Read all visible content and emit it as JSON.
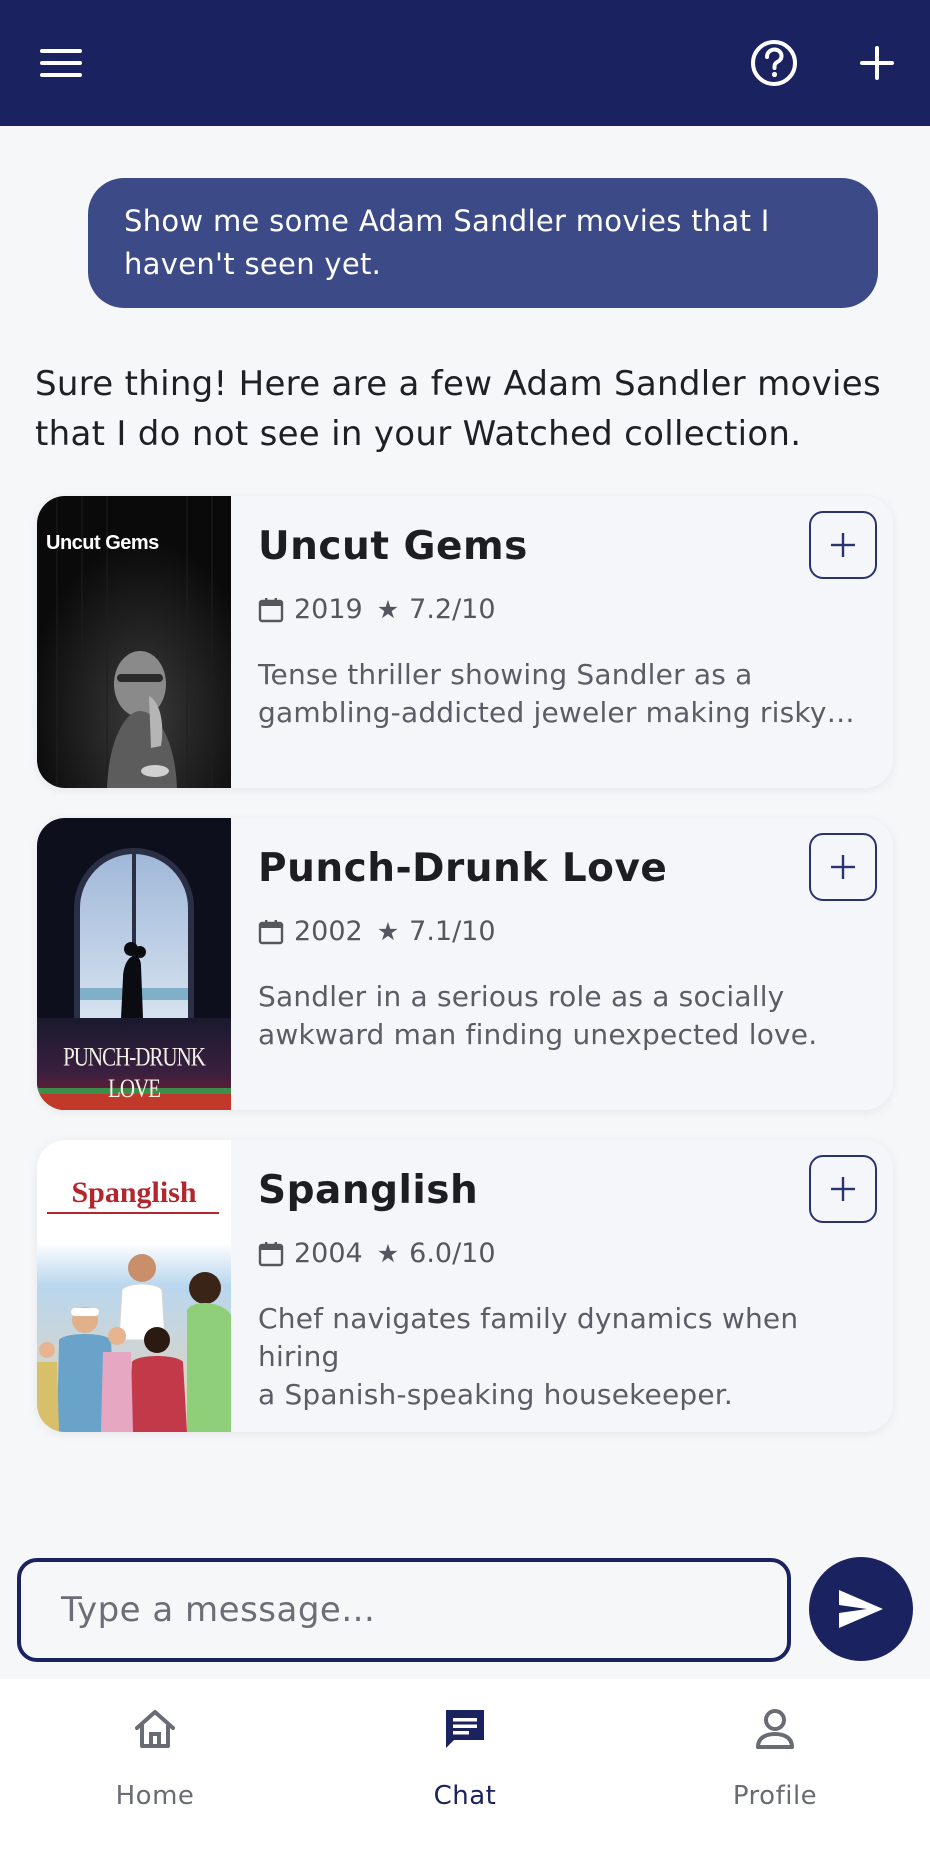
{
  "header": {
    "menu_icon": "menu-icon",
    "help_icon": "help-circle-icon",
    "add_icon": "plus-icon",
    "background": "#1b2260"
  },
  "chat": {
    "user_message": "Show me some Adam Sandler movies that I haven't seen yet.",
    "assistant_message": "Sure thing! Here are a few Adam Sandler movies that I do not see in your Watched collection."
  },
  "movies": [
    {
      "title": "Uncut Gems",
      "year": "2019",
      "rating": "7.2/10",
      "description_line1": "Tense thriller showing Sandler as a",
      "description_line2": "gambling-addicted jeweler making risky b...",
      "poster_text": "Uncut Gems"
    },
    {
      "title": "Punch-Drunk Love",
      "year": "2002",
      "rating": "7.1/10",
      "description_line1": "Sandler in a serious role as a socially",
      "description_line2": "awkward man finding unexpected love.",
      "poster_text": "PUNCH-DRUNK LOVE"
    },
    {
      "title": "Spanglish",
      "year": "2004",
      "rating": "6.0/10",
      "description_line1": "Chef navigates family dynamics when hiring",
      "description_line2": "a Spanish-speaking housekeeper.",
      "poster_text": "Spanglish"
    }
  ],
  "composer": {
    "placeholder": "Type a message...",
    "send_icon": "send-icon"
  },
  "nav": {
    "items": [
      {
        "label": "Home",
        "icon": "home-icon",
        "active": false
      },
      {
        "label": "Chat",
        "icon": "chat-icon",
        "active": true
      },
      {
        "label": "Profile",
        "icon": "profile-icon",
        "active": false
      }
    ]
  },
  "colors": {
    "primary": "#1b2260",
    "user_bubble": "#3d4a88",
    "background": "#f6f7f9"
  }
}
